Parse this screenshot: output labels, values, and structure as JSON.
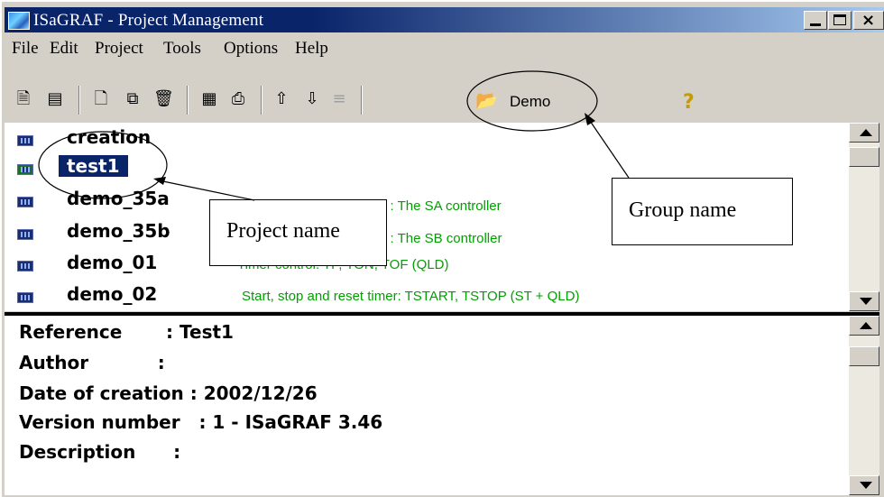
{
  "window": {
    "title": "ISaGRAF - Project Management"
  },
  "menu": [
    {
      "label": "File"
    },
    {
      "label": "Edit"
    },
    {
      "label": "Project"
    },
    {
      "label": "Tools"
    },
    {
      "label": "Options"
    },
    {
      "label": "Help"
    }
  ],
  "toolbar": {
    "group_label": "Demo"
  },
  "projects": [
    {
      "name": "creation",
      "description": ""
    },
    {
      "name": "test1",
      "description": "",
      "selected": true
    },
    {
      "name": "demo_35a",
      "description": "n : The SA controller"
    },
    {
      "name": "demo_35b",
      "description": "n : The SB controller"
    },
    {
      "name": "demo_01",
      "description": "Timer control:  TP, TON, TOF  (QLD)"
    },
    {
      "name": "demo_02",
      "description": "Start, stop and reset timer:  TSTART, TSTOP  (ST + QLD)"
    }
  ],
  "info": {
    "reference": "Reference       : Test1",
    "author": "Author           :",
    "date": "Date of creation : 2002/12/26",
    "version": "Version number   : 1 - ISaGRAF 3.46",
    "description": "Description      :"
  },
  "annotations": {
    "project_name": "Project name",
    "group_name": "Group name"
  },
  "colors": {
    "title_bar": "#0a246a",
    "selection": "#0a246a",
    "description_text": "#00a000",
    "window_face": "#d4d0c8"
  }
}
